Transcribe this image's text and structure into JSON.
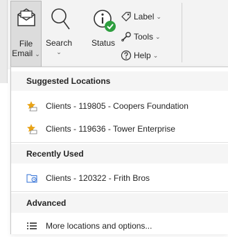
{
  "ribbon": {
    "file_email": {
      "line1": "File",
      "line2": "Email"
    },
    "search": {
      "label": "Search"
    },
    "status": {
      "label": "Status"
    },
    "label": {
      "label": "Label"
    },
    "tools": {
      "label": "Tools"
    },
    "help": {
      "label": "Help"
    }
  },
  "menu": {
    "sections": {
      "suggested": "Suggested Locations",
      "recent": "Recently Used",
      "advanced": "Advanced"
    },
    "items": {
      "suggested1": "Clients - 119805 - Coopers Foundation",
      "suggested2": "Clients - 119636 - Tower Enterprise",
      "recent1": "Clients - 120322 - Frith Bros",
      "more": "More locations and options..."
    }
  },
  "colors": {
    "status_check": "#2e9e3f",
    "star": "#e8a317",
    "folder_blue": "#2f6fd6"
  }
}
